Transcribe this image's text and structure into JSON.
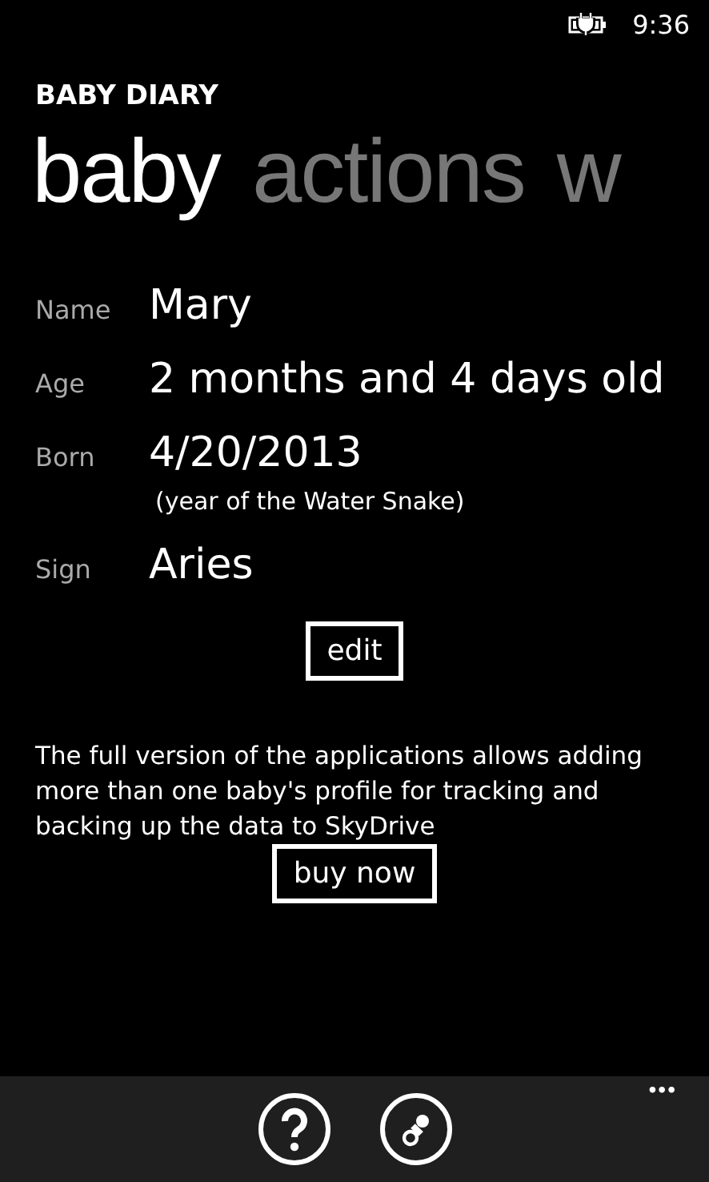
{
  "status_bar": {
    "time": "9:36"
  },
  "app_title": "BABY DIARY",
  "pivot": [
    {
      "label": "baby",
      "selected": true
    },
    {
      "label": "actions",
      "selected": false
    },
    {
      "label": "w",
      "selected": false
    }
  ],
  "fields": [
    {
      "label": "Name",
      "value": "Mary"
    },
    {
      "label": "Age",
      "value": "2 months and 4 days old"
    },
    {
      "label": "Born",
      "value": "4/20/2013",
      "note": "(year of the Water Snake)"
    },
    {
      "label": "Sign",
      "value": "Aries"
    }
  ],
  "edit_button": "edit",
  "promo_text": "The full version of the applications allows adding more than one baby's profile for tracking and backing up the data to SkyDrive",
  "buy_button": "buy now",
  "app_bar": {
    "buttons": [
      {
        "kind": "help"
      },
      {
        "kind": "pacifier"
      }
    ],
    "more": "•••"
  }
}
